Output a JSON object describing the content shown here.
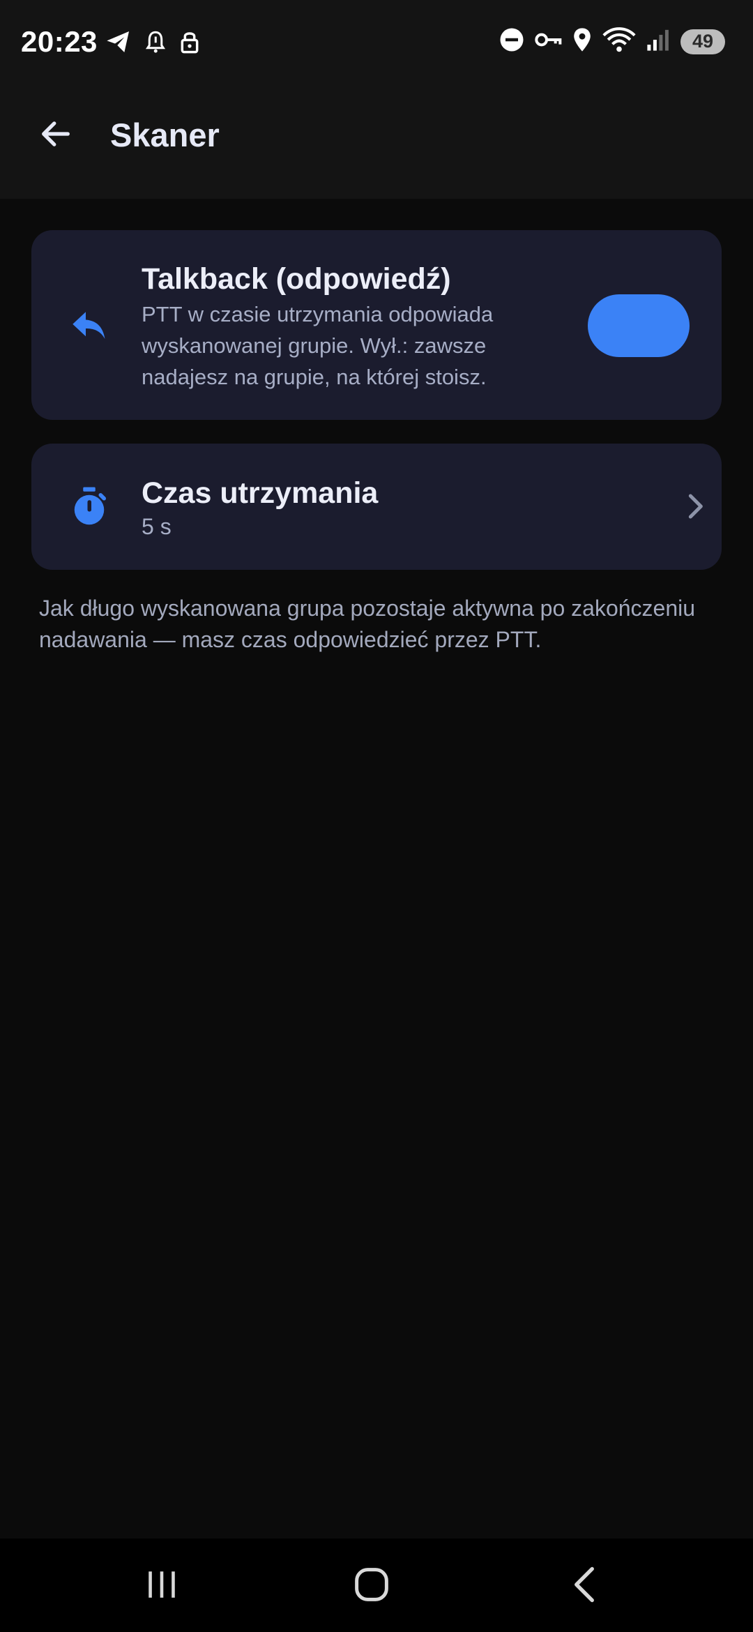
{
  "status_bar": {
    "time": "20:23",
    "battery": "49",
    "left_icons": [
      "telegram-icon",
      "alarm-icon",
      "lock-icon"
    ],
    "right_icons": [
      "do-not-disturb-icon",
      "vpn-key-icon",
      "location-icon",
      "wifi-icon",
      "signal-icon"
    ]
  },
  "app_bar": {
    "title": "Skaner",
    "back_icon": "arrow-back-icon"
  },
  "talkback_card": {
    "title": "Talkback (odpowiedź)",
    "description": "PTT w czasie utrzymania odpowiada wyskanowanej grupie. Wył.: zawsze nadajesz na grupie, na której stoisz.",
    "icon": "reply-icon",
    "toggle_on": true
  },
  "hold_time_card": {
    "title": "Czas utrzymania",
    "value": "5 s",
    "icon": "timer-icon",
    "chevron_icon": "chevron-right-icon"
  },
  "footnote": "Jak długo wyskanowana grupa pozostaje aktywna po zakończeniu nadawania — masz czas odpowiedzieć przez PTT.",
  "colors": {
    "accent": "#3b82f6",
    "card_bg": "#1b1c2e",
    "background": "#0b0b0b",
    "bar_bg": "#141414"
  },
  "nav_bar": {
    "buttons": [
      "recents-icon",
      "home-icon",
      "back-icon"
    ]
  }
}
